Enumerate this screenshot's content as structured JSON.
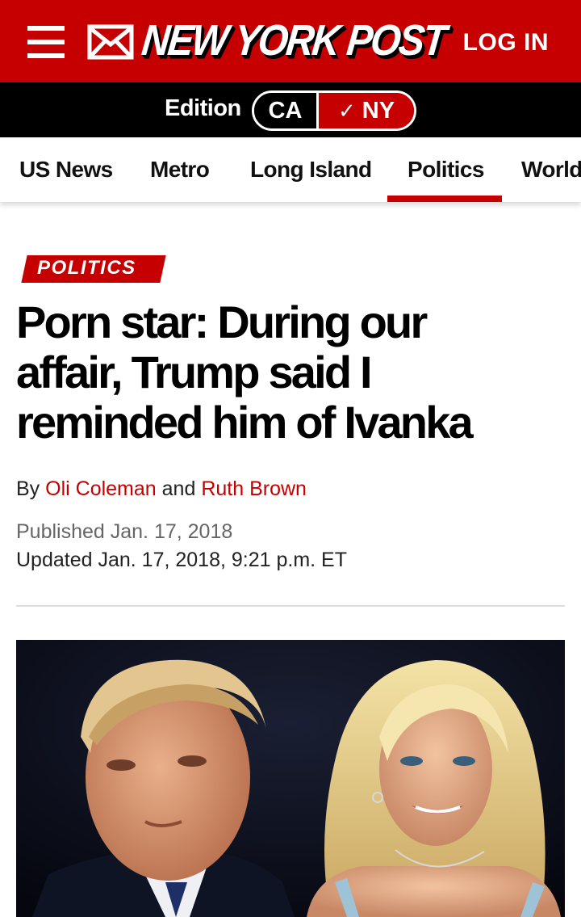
{
  "header": {
    "logo_text": "NEW YORK POST",
    "login_label": "LOG IN",
    "menu_icon": "hamburger-menu-icon",
    "mail_icon": "envelope-icon",
    "brand_red": "#c60000"
  },
  "edition": {
    "label": "Edition",
    "options": [
      {
        "label": "CA",
        "selected": false
      },
      {
        "label": "NY",
        "selected": true,
        "check_glyph": "✓"
      }
    ]
  },
  "nav": {
    "items": [
      "US News",
      "Metro",
      "Long Island",
      "Politics",
      "World"
    ],
    "active": "Politics"
  },
  "article": {
    "section": "POLITICS",
    "headline_lines": [
      "Porn star: During our",
      "affair, Trump said I",
      "reminded him of Ivanka"
    ],
    "by_prefix": "By",
    "author_1": "Oli Coleman",
    "and_word": "and",
    "author_2": "Ruth Brown",
    "published": "Published Jan. 17, 2018",
    "updated": "Updated Jan. 17, 2018, 9:21 p.m. ET"
  }
}
